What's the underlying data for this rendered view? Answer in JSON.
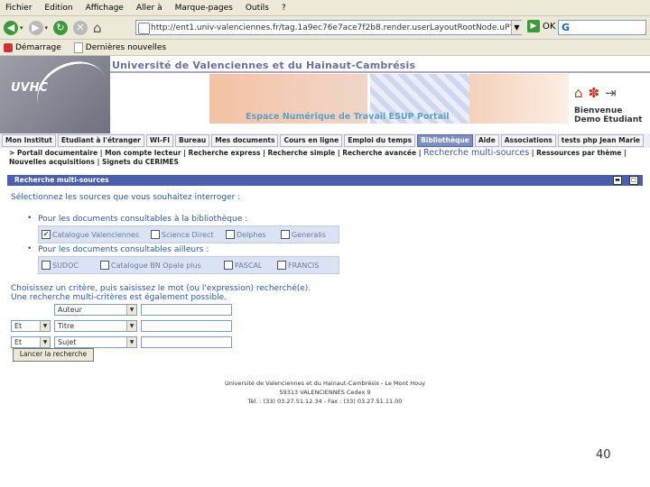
{
  "browser": {
    "menus": [
      "Fichier",
      "Edition",
      "Affichage",
      "Aller à",
      "Marque-pages",
      "Outils",
      "?"
    ],
    "url": "http://ent1.univ-valenciennes.fr/tag.1a9ec76e7ace7f2b8.render.userLayoutRootNode.uP?uP_tparam=minimize",
    "go_label": "OK",
    "search_value": "G",
    "bookmarks": [
      "Démarrage",
      "Dernières nouvelles"
    ]
  },
  "banner": {
    "logo_text": "UVHC",
    "university": "Université de Valenciennes et du Hainaut-Cambrésis",
    "portal": "Espace Numérique de Travail ESUP Portail",
    "welcome_1": "Bienvenue",
    "welcome_2": "Demo Etudiant"
  },
  "tabs": [
    "Mon Institut",
    "Etudiant à l'étranger",
    "WI-FI",
    "Bureau",
    "Mes documents",
    "Cours en ligne",
    "Emploi du temps",
    "Bibliothèque",
    "Aide",
    "Associations",
    "tests php Jean Marie"
  ],
  "subnav": {
    "part1": "> Portail documentaire | Mon compte lecteur | Recherche express | Recherche simple | Recherche avancée | ",
    "selected": "Recherche multi-sources",
    "part2": " | Ressources par thème | Nouvelles acquisitions | Signets du CERIMES"
  },
  "panel": {
    "title": "Recherche multi-sources",
    "prompt": "Sélectionnez les sources que vous souhaitez interroger :",
    "group1_label": "Pour les documents consultables à la bibliothèque :",
    "group1": [
      {
        "label": "Catalogue Valenciennes",
        "checked": true
      },
      {
        "label": "Science Direct",
        "checked": false
      },
      {
        "label": "Delphes",
        "checked": false
      },
      {
        "label": "Generalis",
        "checked": false
      }
    ],
    "group2_label": "Pour les documents consultables ailleurs :",
    "group2": [
      {
        "label": "SUDOC",
        "checked": false
      },
      {
        "label": "Catalogue BN Opale plus",
        "checked": false
      },
      {
        "label": "PASCAL",
        "checked": false
      },
      {
        "label": "FRANCIS",
        "checked": false
      }
    ],
    "instruction_1": "Choisissez un critère, puis saisissez le mot (ou l'expression) recherché(e).",
    "instruction_2": "Une recherche multi-critères est également possible.",
    "criteria": [
      {
        "op": "",
        "field": "Auteur"
      },
      {
        "op": "Et",
        "field": "Titre"
      },
      {
        "op": "Et",
        "field": "Sujet"
      }
    ],
    "search_button": "Lancer la recherche"
  },
  "footer": {
    "line1": "Université de Valenciennes et du Hainaut-Cambrésis - Le Mont Houy",
    "line2": "59313 VALENCIENNES Cedex 9",
    "line3": "Tél. : (33) 03.27.51.12.34 - Fax : (33) 03.27.51.11.00"
  },
  "page_number": "40"
}
